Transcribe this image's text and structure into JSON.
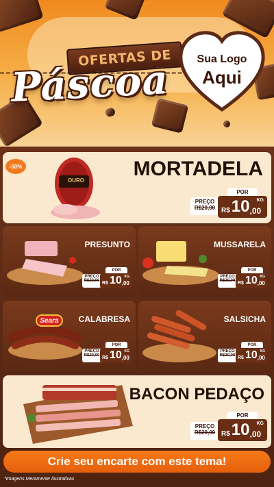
{
  "header": {
    "banner_top": "OFERTAS DE",
    "banner_main": "Páscoa",
    "logo_line1": "Sua Logo",
    "logo_line2": "Aqui"
  },
  "discount_badge": "-50%",
  "products": [
    {
      "name": "MORTADELA",
      "brand_label": "OURO",
      "price_label": "PREÇO",
      "old_price": "R$20,00",
      "por_label": "POR",
      "currency": "R$",
      "price_int": "10",
      "price_dec": ",00",
      "unit": "KG"
    },
    {
      "name": "PRESUNTO",
      "price_label": "PREÇO",
      "old_price": "R$20,00",
      "por_label": "POR",
      "currency": "R$",
      "price_int": "10",
      "price_dec": ",00",
      "unit": "KG"
    },
    {
      "name": "MUSSARELA",
      "price_label": "PREÇO",
      "old_price": "R$20,00",
      "por_label": "POR",
      "currency": "R$",
      "price_int": "10",
      "price_dec": ",00",
      "unit": "KG"
    },
    {
      "name": "CALABRESA",
      "brand_label": "Seara",
      "price_label": "PREÇO",
      "old_price": "R$20,00",
      "por_label": "POR",
      "currency": "R$",
      "price_int": "10",
      "price_dec": ",00",
      "unit": "KG"
    },
    {
      "name": "SALSICHA",
      "price_label": "PREÇO",
      "old_price": "R$20,00",
      "por_label": "POR",
      "currency": "R$",
      "price_int": "10",
      "price_dec": ",00",
      "unit": "KG"
    },
    {
      "name": "BACON PEDAÇO",
      "price_label": "PREÇO",
      "old_price": "R$20,00",
      "por_label": "POR",
      "currency": "R$",
      "price_int": "10",
      "price_dec": ",00",
      "unit": "KG"
    }
  ],
  "cta": "Crie seu encarte com este tema!",
  "disclaimer": "*Imagens Meramente Ilustrativas",
  "colors": {
    "orange": "#f08a1e",
    "chocolate": "#5a2a17",
    "cream": "#fbe9cf",
    "price_bg": "#6a2e14"
  }
}
